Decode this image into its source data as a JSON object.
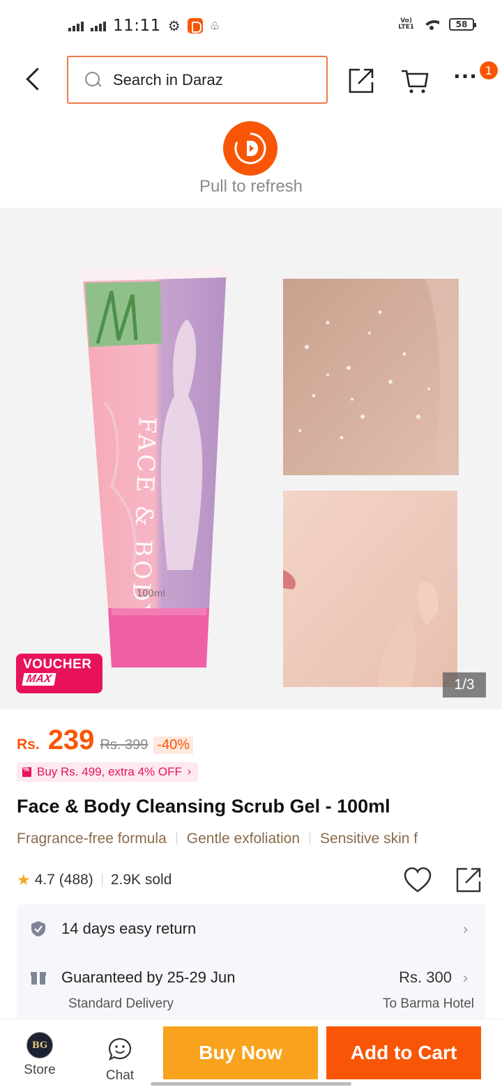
{
  "status_bar": {
    "time": "11:11",
    "network": "Vo) LTE1",
    "battery": "58"
  },
  "header": {
    "search_placeholder": "Search in Daraz",
    "notification_count": "1"
  },
  "refresh": {
    "text": "Pull to refresh"
  },
  "gallery": {
    "product_image": "pink face & body scrub gel tube (100ml) beside before/after skin photos",
    "voucher_top": "VOUCHER",
    "voucher_bottom": "MAX",
    "counter": "1/3"
  },
  "price": {
    "currency": "Rs.",
    "current": "239",
    "original": "Rs. 399",
    "discount": "-40%"
  },
  "promo": {
    "text": "Buy Rs. 499, extra 4% OFF"
  },
  "product": {
    "title": "Face & Body Cleansing Scrub Gel - 100ml",
    "features": [
      "Fragrance-free formula",
      "Gentle exfoliation",
      "Sensitive skin f"
    ],
    "rating": "4.7",
    "reviews": "(488)",
    "sold": "2.9K sold"
  },
  "service": {
    "return_text": "14 days easy return",
    "delivery_text": "Guaranteed by 25-29 Jun",
    "delivery_fee": "Rs. 300",
    "delivery_type": "Standard Delivery",
    "delivery_dest": "To Barma Hotel"
  },
  "bottom_bar": {
    "store_label": "Store",
    "store_logo_text": "BG",
    "chat_label": "Chat",
    "buy_now": "Buy Now",
    "add_to_cart": "Add to Cart"
  },
  "colors": {
    "brand": "#f85606",
    "buy_now": "#f9a21d",
    "voucher": "#e8125c"
  }
}
